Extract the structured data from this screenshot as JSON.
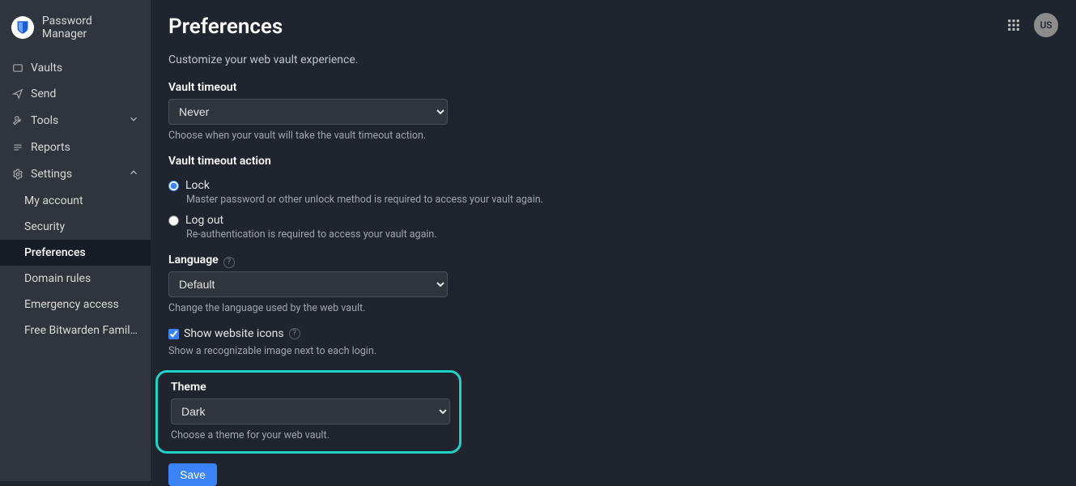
{
  "brand": {
    "name": "Password Manager"
  },
  "sidebar": {
    "items": [
      {
        "label": "Vaults"
      },
      {
        "label": "Send"
      },
      {
        "label": "Tools"
      },
      {
        "label": "Reports"
      },
      {
        "label": "Settings"
      }
    ],
    "settingsChildren": [
      {
        "label": "My account"
      },
      {
        "label": "Security"
      },
      {
        "label": "Preferences"
      },
      {
        "label": "Domain rules"
      },
      {
        "label": "Emergency access"
      },
      {
        "label": "Free Bitwarden Famil…"
      }
    ]
  },
  "header": {
    "avatarInitials": "US"
  },
  "page": {
    "title": "Preferences",
    "subtitle": "Customize your web vault experience."
  },
  "vaultTimeout": {
    "label": "Vault timeout",
    "value": "Never",
    "help": "Choose when your vault will take the vault timeout action."
  },
  "vaultTimeoutAction": {
    "label": "Vault timeout action",
    "options": [
      {
        "label": "Lock",
        "help": "Master password or other unlock method is required to access your vault again."
      },
      {
        "label": "Log out",
        "help": "Re-authentication is required to access your vault again."
      }
    ]
  },
  "language": {
    "label": "Language",
    "value": "Default",
    "help": "Change the language used by the web vault."
  },
  "showIcons": {
    "label": "Show website icons",
    "help": "Show a recognizable image next to each login."
  },
  "theme": {
    "label": "Theme",
    "value": "Dark",
    "help": "Choose a theme for your web vault."
  },
  "buttons": {
    "save": "Save"
  }
}
